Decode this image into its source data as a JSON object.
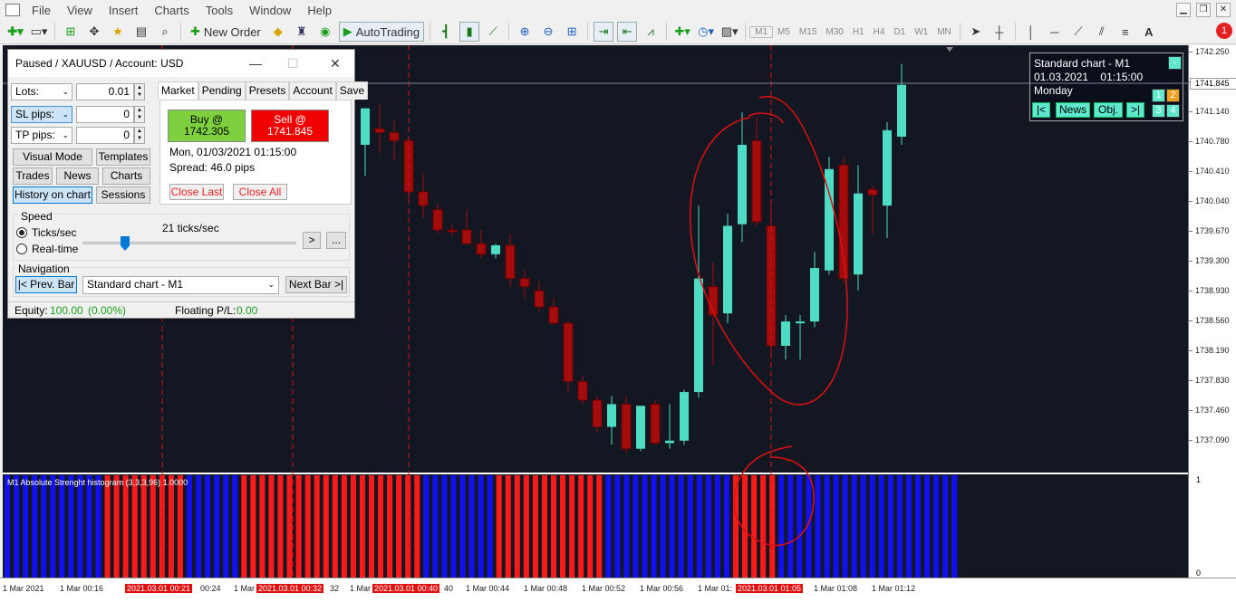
{
  "menu": [
    "File",
    "View",
    "Insert",
    "Charts",
    "Tools",
    "Window",
    "Help"
  ],
  "toolbar": {
    "new_order": "New Order",
    "autotrading": "AutoTrading",
    "timeframes": [
      "M1",
      "M5",
      "M15",
      "M30",
      "H1",
      "H4",
      "D1",
      "W1",
      "MN"
    ],
    "notification_count": "1"
  },
  "chart": {
    "price_labels": [
      "1742.250",
      "1741.845",
      "1741.510",
      "1741.140",
      "1740.780",
      "1740.410",
      "1740.040",
      "1739.670",
      "1739.300",
      "1738.930",
      "1738.560",
      "1738.190",
      "1737.830",
      "1737.460",
      "1737.090"
    ],
    "current_price": "1741.845",
    "indicator_label": "M1 Absolute Strenght histogram (3,3,3,96) 1.0000",
    "indicator_scale": [
      "1",
      "0"
    ],
    "time_labels": [
      "1 Mar 2021",
      "1 Mar 00:16",
      "00:24",
      "1 Mar",
      "32",
      "1 Mar",
      "40",
      "1 Mar 00:44",
      "1 Mar 00:48",
      "1 Mar 00:52",
      "1 Mar 00:56",
      "1 Mar 01:",
      "1 Mar 01:08",
      "1 Mar 01:12"
    ],
    "time_highlights": [
      "2021.03.01 00:21",
      "2021.03.01 00:32",
      "2021.03.01 00:40",
      "2021.03.01 01:05"
    ],
    "candles": [
      {
        "o": 1741.1,
        "h": 1741.55,
        "l": 1740.72,
        "c": 1741.55
      },
      {
        "o": 1741.3,
        "h": 1741.6,
        "l": 1741.0,
        "c": 1741.25
      },
      {
        "o": 1741.25,
        "h": 1741.4,
        "l": 1740.9,
        "c": 1741.15
      },
      {
        "o": 1741.15,
        "h": 1741.2,
        "l": 1740.4,
        "c": 1740.52
      },
      {
        "o": 1740.52,
        "h": 1740.75,
        "l": 1740.2,
        "c": 1740.35
      },
      {
        "o": 1740.3,
        "h": 1740.38,
        "l": 1740.0,
        "c": 1740.05
      },
      {
        "o": 1740.05,
        "h": 1740.12,
        "l": 1739.98,
        "c": 1740.04
      },
      {
        "o": 1740.05,
        "h": 1740.3,
        "l": 1739.95,
        "c": 1739.88
      },
      {
        "o": 1739.88,
        "h": 1740.05,
        "l": 1739.7,
        "c": 1739.75
      },
      {
        "o": 1739.75,
        "h": 1739.88,
        "l": 1739.7,
        "c": 1739.86
      },
      {
        "o": 1739.86,
        "h": 1740.0,
        "l": 1739.35,
        "c": 1739.45
      },
      {
        "o": 1739.45,
        "h": 1739.55,
        "l": 1739.2,
        "c": 1739.35
      },
      {
        "o": 1739.3,
        "h": 1739.42,
        "l": 1739.05,
        "c": 1739.1
      },
      {
        "o": 1739.1,
        "h": 1739.2,
        "l": 1738.88,
        "c": 1738.9
      },
      {
        "o": 1738.9,
        "h": 1738.92,
        "l": 1738.05,
        "c": 1738.18
      },
      {
        "o": 1738.18,
        "h": 1738.25,
        "l": 1737.9,
        "c": 1737.95
      },
      {
        "o": 1737.95,
        "h": 1738.0,
        "l": 1737.55,
        "c": 1737.62
      },
      {
        "o": 1737.62,
        "h": 1738.0,
        "l": 1737.4,
        "c": 1737.9
      },
      {
        "o": 1737.9,
        "h": 1738.0,
        "l": 1737.3,
        "c": 1737.35
      },
      {
        "o": 1737.35,
        "h": 1737.88,
        "l": 1737.32,
        "c": 1737.88
      },
      {
        "o": 1737.9,
        "h": 1737.95,
        "l": 1737.4,
        "c": 1737.42
      },
      {
        "o": 1737.42,
        "h": 1737.9,
        "l": 1737.35,
        "c": 1737.45
      },
      {
        "o": 1737.45,
        "h": 1738.08,
        "l": 1737.4,
        "c": 1738.05
      },
      {
        "o": 1738.05,
        "h": 1740.35,
        "l": 1737.98,
        "c": 1739.45
      },
      {
        "o": 1739.35,
        "h": 1739.65,
        "l": 1738.38,
        "c": 1739.0
      },
      {
        "o": 1739.02,
        "h": 1740.25,
        "l": 1738.9,
        "c": 1740.1
      },
      {
        "o": 1740.12,
        "h": 1741.5,
        "l": 1739.9,
        "c": 1741.1
      },
      {
        "o": 1741.15,
        "h": 1741.45,
        "l": 1740.1,
        "c": 1740.15
      },
      {
        "o": 1740.1,
        "h": 1740.4,
        "l": 1738.48,
        "c": 1738.62
      },
      {
        "o": 1738.62,
        "h": 1739.0,
        "l": 1738.45,
        "c": 1738.92
      },
      {
        "o": 1738.92,
        "h": 1739.0,
        "l": 1738.45,
        "c": 1738.92
      },
      {
        "o": 1738.92,
        "h": 1739.78,
        "l": 1738.85,
        "c": 1739.58
      },
      {
        "o": 1739.55,
        "h": 1740.95,
        "l": 1739.5,
        "c": 1740.8
      },
      {
        "o": 1740.85,
        "h": 1740.95,
        "l": 1739.4,
        "c": 1739.45
      },
      {
        "o": 1739.5,
        "h": 1740.85,
        "l": 1739.3,
        "c": 1740.5
      },
      {
        "o": 1740.55,
        "h": 1740.6,
        "l": 1740.0,
        "c": 1740.48
      },
      {
        "o": 1740.35,
        "h": 1741.38,
        "l": 1739.95,
        "c": 1741.28
      },
      {
        "o": 1741.2,
        "h": 1742.1,
        "l": 1741.1,
        "c": 1741.84
      }
    ],
    "histogram": [
      "blue",
      "blue",
      "blue",
      "blue",
      "blue",
      "blue",
      "blue",
      "blue",
      "blue",
      "blue",
      "blue",
      "red",
      "red",
      "red",
      "red",
      "red",
      "red",
      "red",
      "red",
      "red",
      "blue",
      "blue",
      "blue",
      "blue",
      "blue",
      "blue",
      "red",
      "red",
      "red",
      "red",
      "red",
      "red",
      "red",
      "red",
      "red",
      "red",
      "red",
      "red",
      "red",
      "red",
      "red",
      "red",
      "red",
      "red",
      "red",
      "red",
      "blue",
      "blue",
      "blue",
      "blue",
      "blue",
      "blue",
      "blue",
      "blue",
      "red",
      "red",
      "red",
      "red",
      "red",
      "red",
      "red",
      "red",
      "red",
      "red",
      "red",
      "red",
      "blue",
      "blue",
      "blue",
      "blue",
      "blue",
      "blue",
      "blue",
      "blue",
      "blue",
      "blue",
      "blue",
      "blue",
      "blue",
      "blue",
      "red",
      "red",
      "red",
      "red",
      "red",
      "blue",
      "blue",
      "blue",
      "blue",
      "blue",
      "blue",
      "blue",
      "blue",
      "blue",
      "blue",
      "blue",
      "blue",
      "blue",
      "blue",
      "blue",
      "blue",
      "blue",
      "blue",
      "blue",
      "blue"
    ]
  },
  "info_box": {
    "title": "Standard chart - M1",
    "date": "01.03.2021",
    "time": "01:15:00",
    "day": "Monday",
    "minus": "-",
    "btn1": "1",
    "btn2": "2",
    "btn3": "3",
    "btn4": "4",
    "first": "|<",
    "news": "News",
    "obj": "Obj.",
    "last": ">|"
  },
  "panel": {
    "title": "Paused / XAUUSD / Account: USD",
    "lots_label": "Lots:",
    "lots_value": "0.01",
    "sl_label": "SL pips:",
    "sl_value": "0",
    "tp_label": "TP pips:",
    "tp_value": "0",
    "buttons": {
      "visual_mode": "Visual Mode",
      "templates": "Templates",
      "trades": "Trades",
      "news": "News",
      "charts": "Charts",
      "history": "History on chart",
      "sessions": "Sessions"
    },
    "tabs": [
      "Market",
      "Pending",
      "Presets",
      "Account",
      "Save"
    ],
    "buy_label": "Buy @",
    "buy_price": "1742.305",
    "sell_label": "Sell @",
    "sell_price": "1741.845",
    "datetime": "Mon, 01/03/2021  01:15:00",
    "spread": "Spread:  46.0 pips",
    "close_last": "Close Last",
    "close_all": "Close All",
    "speed_label": "Speed",
    "ticks_label": "Ticks/sec",
    "realtime_label": "Real-time",
    "ticks_value": "21 ticks/sec",
    "play": ">",
    "more": "...",
    "nav_label": "Navigation",
    "prev_bar": "|< Prev. Bar",
    "chart_select": "Standard chart - M1",
    "next_bar": "Next Bar >|",
    "equity_label": "Equity:",
    "equity_value": "100.00",
    "equity_pct": "(0.00%)",
    "floating_label": "Floating P/L:",
    "floating_value": "0.00"
  },
  "colors": {
    "bull": "#4fdcc4",
    "bear": "#a50d0d",
    "hist_red": "#ff1a1a",
    "hist_blue": "#1010f0"
  }
}
